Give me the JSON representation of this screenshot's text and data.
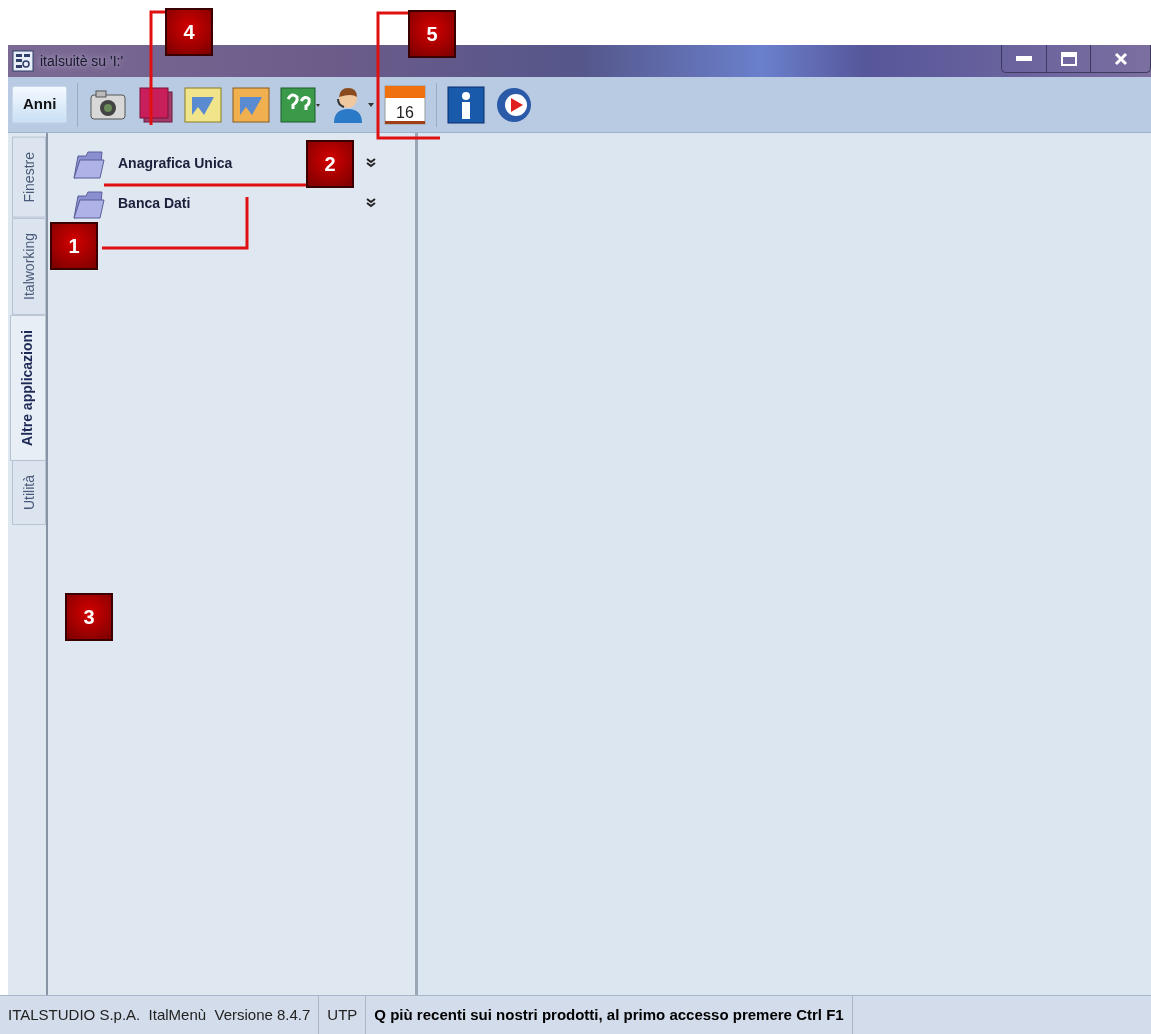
{
  "window": {
    "title": "italsuitè su 'I:'"
  },
  "toolbar": {
    "years_button": "Anni",
    "calendar_day": "16"
  },
  "side_tabs": [
    {
      "label": "Finestre",
      "selected": false
    },
    {
      "label": "Italworking",
      "selected": false
    },
    {
      "label": "Altre applicazioni",
      "selected": true
    },
    {
      "label": "Utilità",
      "selected": false
    }
  ],
  "menu_items": [
    {
      "label": "Anagrafica Unica"
    },
    {
      "label": "Banca Dati"
    }
  ],
  "status_bar": {
    "product": "ITALSTUDIO S.p.A.  ItalMenù  Versione 8.4.7",
    "user": "UTP",
    "message": "Q più recenti sui nostri prodotti, al primo accesso premere Ctrl F1"
  },
  "callouts": [
    "4",
    "5",
    "2",
    "1",
    "3"
  ]
}
